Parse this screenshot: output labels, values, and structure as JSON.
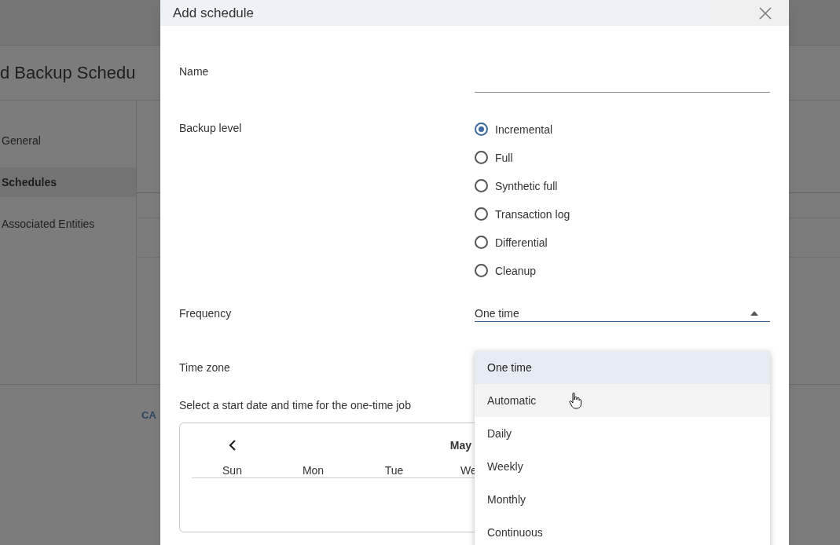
{
  "background_page": {
    "title": "d Backup Schedu",
    "nav_items": [
      {
        "label": "General",
        "selected": false
      },
      {
        "label": "Schedules",
        "selected": true
      },
      {
        "label": "Associated Entities",
        "selected": false
      }
    ],
    "footer_button": "CA"
  },
  "dialog": {
    "title": "Add schedule",
    "name_label": "Name",
    "backup_level_label": "Backup level",
    "backup_levels": [
      {
        "label": "Incremental",
        "selected": true
      },
      {
        "label": "Full",
        "selected": false
      },
      {
        "label": "Synthetic full",
        "selected": false
      },
      {
        "label": "Transaction log",
        "selected": false
      },
      {
        "label": "Differential",
        "selected": false
      },
      {
        "label": "Cleanup",
        "selected": false
      }
    ],
    "frequency_label": "Frequency",
    "frequency_value": "One time",
    "time_zone_label": "Time zone",
    "start_prompt": "Select a start date and time for the one-time job",
    "calendar": {
      "month": "May",
      "weekdays": [
        "Sun",
        "Mon",
        "Tue",
        "We"
      ]
    }
  },
  "frequency_menu": [
    {
      "label": "One time",
      "selected": true,
      "hovered": false
    },
    {
      "label": "Automatic",
      "selected": false,
      "hovered": true
    },
    {
      "label": "Daily",
      "selected": false,
      "hovered": false
    },
    {
      "label": "Weekly",
      "selected": false,
      "hovered": false
    },
    {
      "label": "Monthly",
      "selected": false,
      "hovered": false
    },
    {
      "label": "Continuous",
      "selected": false,
      "hovered": false
    }
  ]
}
